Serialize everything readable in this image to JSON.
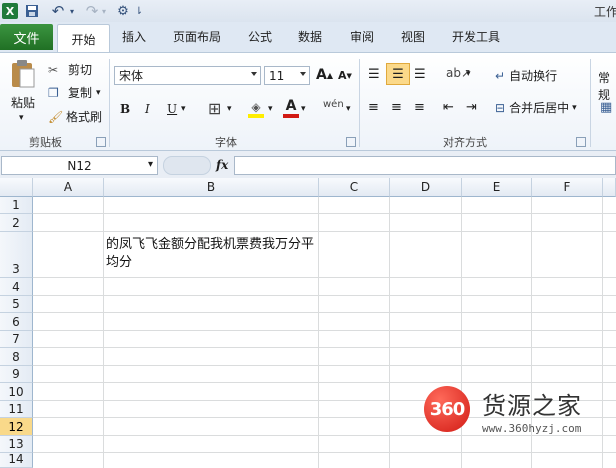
{
  "app": {
    "title": "工作",
    "icons": {
      "excel": "excel-icon",
      "save": "save-icon",
      "undo": "undo-icon",
      "redo": "redo-icon",
      "customize": "customize-qat-icon"
    }
  },
  "tabs": [
    "文件",
    "开始",
    "插入",
    "页面布局",
    "公式",
    "数据",
    "审阅",
    "视图",
    "开发工具"
  ],
  "ribbon": {
    "clipboard": {
      "paste": "粘贴",
      "cut": "剪切",
      "copy": "复制",
      "format_painter": "格式刷",
      "group": "剪贴板"
    },
    "font": {
      "name": "宋体",
      "size": "11",
      "bold": "B",
      "italic": "I",
      "underline": "U",
      "phonetic": "wén",
      "group": "字体"
    },
    "align": {
      "wrap": "自动换行",
      "merge": "合并后居中",
      "group": "对齐方式"
    },
    "number": {
      "format": "常规"
    }
  },
  "formula_bar": {
    "name_box": "N12",
    "fx": "fx",
    "content": ""
  },
  "grid": {
    "columns": [
      "A",
      "B",
      "C",
      "D",
      "E",
      "F"
    ],
    "rows": [
      "1",
      "2",
      "3",
      "4",
      "5",
      "6",
      "7",
      "8",
      "9",
      "10",
      "11",
      "12",
      "13",
      "14"
    ],
    "selected_row": "12",
    "cell_b3": "的凤飞飞金额分配我机票费我万分平均分"
  },
  "watermark": {
    "badge": "360",
    "name": "货源之家",
    "url": "www.360hyzj.com"
  },
  "colors": {
    "file_tab": "#2e7d32",
    "selected_row": "#f9d98a",
    "font_color_red": "#d11a14",
    "highlight_yellow": "#ffee00"
  }
}
